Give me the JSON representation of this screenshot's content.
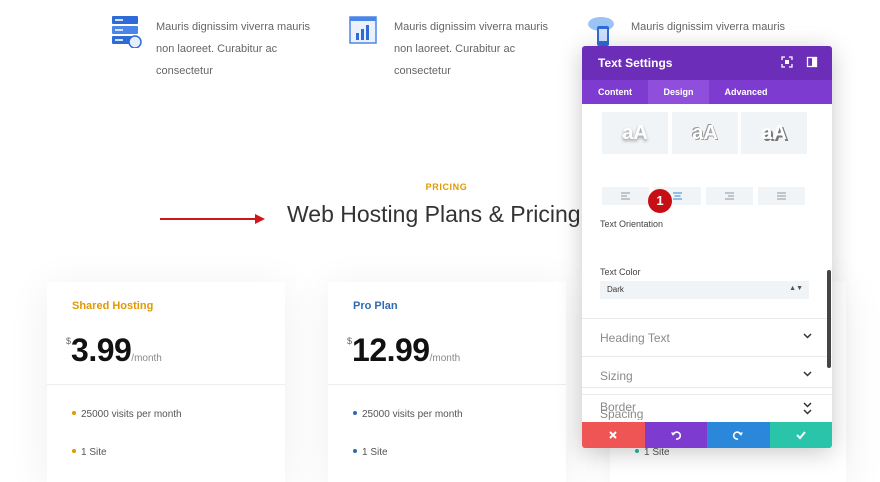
{
  "features": [
    {
      "text": "Mauris dignissim viverra mauris non laoreet. Curabitur ac consectetur",
      "icon": "server-icon"
    },
    {
      "text": "Mauris dignissim viverra mauris non laoreet. Curabitur ac consectetur",
      "icon": "chart-monitor-icon"
    },
    {
      "text": "Mauris dignissim viverra mauris",
      "icon": "cloud-phone-icon"
    }
  ],
  "section": {
    "label": "PRICING",
    "title": "Web Hosting Plans & Pricing"
  },
  "plans": [
    {
      "name": "Shared Hosting",
      "currency": "$",
      "price": "3.99",
      "period": "/month",
      "features": [
        "25000 visits per month",
        "1 Site"
      ],
      "color": "#e09900"
    },
    {
      "name": "Pro Plan",
      "currency": "$",
      "price": "12.99",
      "period": "/month",
      "features": [
        "25000 visits per month",
        "1 Site"
      ],
      "color": "#2e6bb3"
    }
  ],
  "third_card": {
    "feature_peek": "1 Site",
    "color": "#2bb59b"
  },
  "panel": {
    "title": "Text Settings",
    "tabs": [
      "Content",
      "Design",
      "Advanced"
    ],
    "active_tab": "Design",
    "tile_sample": "aA",
    "orientation_label": "Text Orientation",
    "color_label": "Text Color",
    "color_value": "Dark",
    "badge": "1",
    "sections": [
      "Heading Text",
      "Sizing",
      "Spacing",
      "Border"
    ]
  },
  "colors": {
    "header": "#6c2eb9",
    "tabs": "#7e3bd0",
    "cancel": "#ef5555",
    "undo": "#7e3bd0",
    "redo": "#2b87da",
    "save": "#29c4a9",
    "arrow": "#d0161d"
  }
}
